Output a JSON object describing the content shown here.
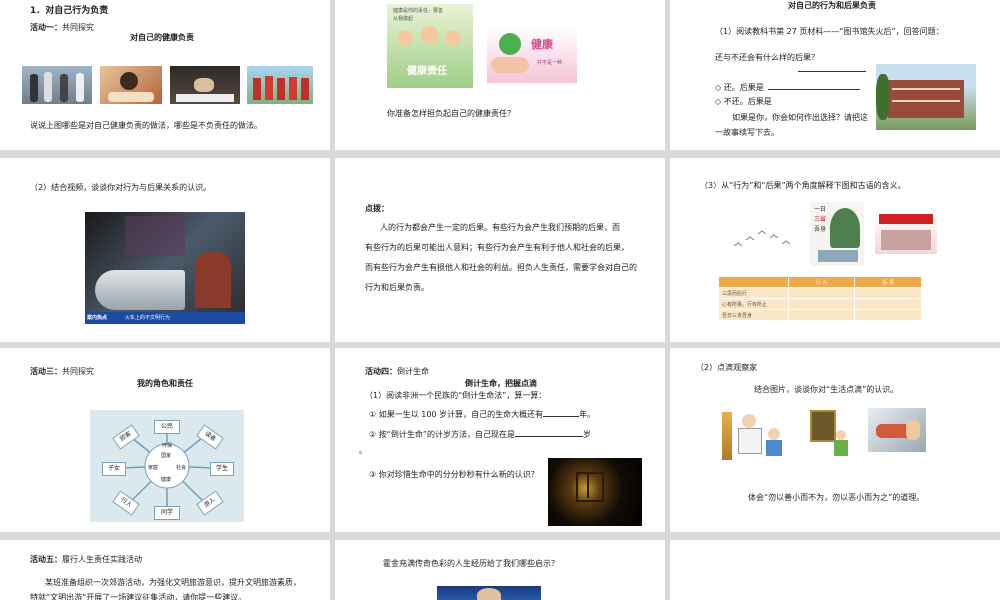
{
  "s1": {
    "heading": "1．对自己行为负责",
    "activity_label": "活动一：",
    "activity_name": "共同探究",
    "subtitle": "对自己的健康负责",
    "question": "说说上图哪些是对自己健康负责的做法，哪些是不负责任的做法。"
  },
  "s2": {
    "poster1_line1": "健康是你的责任，要善",
    "poster1_line2": "从我做起",
    "poster1_big": "健康责任",
    "poster2_big": "健康",
    "poster2_small": "并不是一种",
    "question": "你准备怎样担负起自己的健康责任？"
  },
  "s3": {
    "title": "对自己的行为和后果负责",
    "line1": "（1）阅读教科书第 27 页材料——“图书馆失火后”，回答问题：",
    "line2": "还与不还会有什么样的后果？",
    "opt1": "◇ 还。后果是",
    "opt2": "◇ 不还。后果是",
    "line3": "如果是你，你会如何作出选择？请把这",
    "line4": "一故事续写下去。"
  },
  "s4": {
    "line1": "（2）结合视频，谈谈你对行为与后果关系的认识。",
    "caption_tag": "案内热点",
    "caption_text": "火车上的不文明行为"
  },
  "s5": {
    "label": "点拨：",
    "p1": "人的行为都会产生一定的后果。有些行为会产生我们预期的后果，而",
    "p2": "有些行为的后果可能出人意料；有些行为会产生有利于他人和社会的后果，",
    "p3": "而有些行为会产生有损他人和社会的利益。担负人生责任，需要学会对自己的",
    "p4": "行为和后果负责。"
  },
  "s6": {
    "line1": "（3）从“行为”和“后果”两个角度解释下图和古语的含义。",
    "img2_text1": "一日",
    "img2_text2": "三省",
    "img2_text3": "吾身",
    "table_headers": [
      "",
      "行 为",
      "后 果"
    ],
    "table_rows": [
      "三思而后行",
      "心有所畏，行有所止",
      "吾日三省吾身"
    ]
  },
  "s7": {
    "activity_label": "活动三：",
    "activity_name": "共同探究",
    "subtitle": "我的角色和责任",
    "center_nodes": [
      "国家",
      "家庭",
      "健康",
      "社会",
      "环保"
    ],
    "outer_nodes": [
      "公民",
      "顾客",
      "读者",
      "子女",
      "学生",
      "游人",
      "行人",
      "同学"
    ]
  },
  "s8": {
    "activity_label": "活动四：",
    "activity_name": "倒计生命",
    "subtitle": "倒计生命，把握点滴",
    "line1": "（1）阅读非洲一个民族的“倒计生命法”，算一算：",
    "q1a": "① 如果一生以 100 岁计算，自己的生命大概还有",
    "q1b": "年。",
    "q2a": "② 按“倒计生命”的计岁方法，自己现在是",
    "q2b": "岁",
    "dot": "。",
    "q3": "③ 你对珍惜生命中的分分秒秒有什么新的认识？"
  },
  "s9": {
    "line1": "（2）点滴观察家",
    "line2": "结合图片，谈谈你对“生活点滴”的认识。",
    "line3": "体会“勿以善小而不为，勿以恶小而为之”的道理。"
  },
  "s10": {
    "activity_label": "活动五：",
    "activity_name": "履行人生责任实践活动",
    "p1": "某班准备组织一次郊游活动，为强化文明旅游意识，提升文明旅游素质，",
    "p2": "特就“文明出游”开展了一场建议征集活动，请你提一些建议。"
  },
  "s11": {
    "line1": "霍金充满传奇色彩的人生经历给了我们哪些启示？"
  },
  "colors": {
    "table_header": "#f0a848",
    "table_row": "#fce7c6",
    "diagram_bg": "#dbe9ee"
  }
}
